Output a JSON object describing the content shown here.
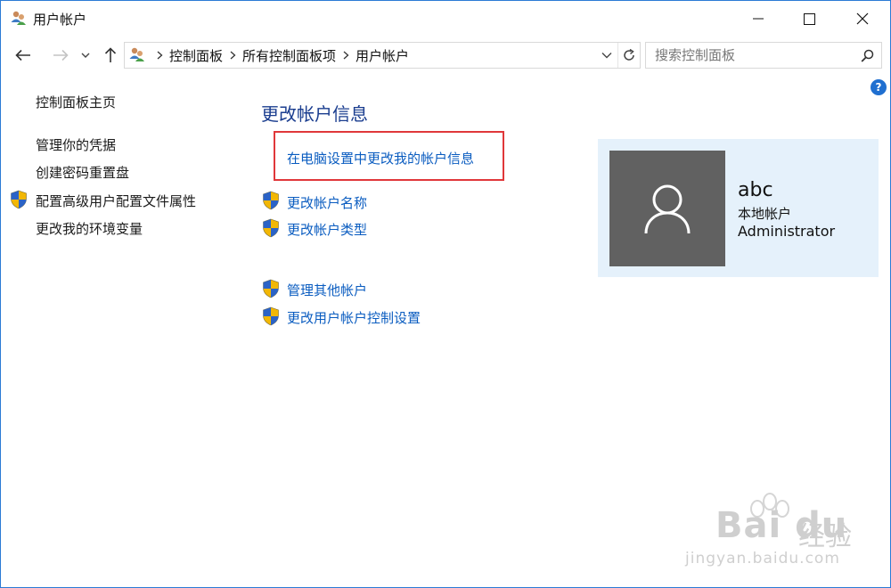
{
  "window": {
    "title": "用户帐户",
    "accent": "#2b7bd5"
  },
  "titlebar_buttons": {
    "minimize": "minimize-icon",
    "maximize": "maximize-icon",
    "close": "close-icon"
  },
  "nav": {
    "breadcrumb": [
      "控制面板",
      "所有控制面板项",
      "用户帐户"
    ],
    "search_placeholder": "搜索控制面板",
    "help_label": "?"
  },
  "sidebar": {
    "items": [
      {
        "label": "控制面板主页",
        "shield": false
      },
      {
        "label": "管理你的凭据",
        "shield": false
      },
      {
        "label": "创建密码重置盘",
        "shield": false
      },
      {
        "label": "配置高级用户配置文件属性",
        "shield": true
      },
      {
        "label": "更改我的环境变量",
        "shield": false
      }
    ]
  },
  "main": {
    "heading": "更改帐户信息",
    "pc_settings_link": "在电脑设置中更改我的帐户信息",
    "links": [
      {
        "label": "更改帐户名称",
        "shield": true
      },
      {
        "label": "更改帐户类型",
        "shield": true
      },
      {
        "label": "管理其他帐户",
        "shield": true
      },
      {
        "label": "更改用户帐户控制设置",
        "shield": true
      }
    ],
    "link_color": "#0a5cc0",
    "heading_color": "#1a3d8f",
    "highlight_color": "#e0373a"
  },
  "user": {
    "name": "abc",
    "type": "本地帐户",
    "role": "Administrator",
    "panel_bg": "#e5f1fb"
  },
  "watermark": {
    "brand": "Bai du",
    "brand_cn": "经验",
    "url": "jingyan.baidu.com"
  }
}
